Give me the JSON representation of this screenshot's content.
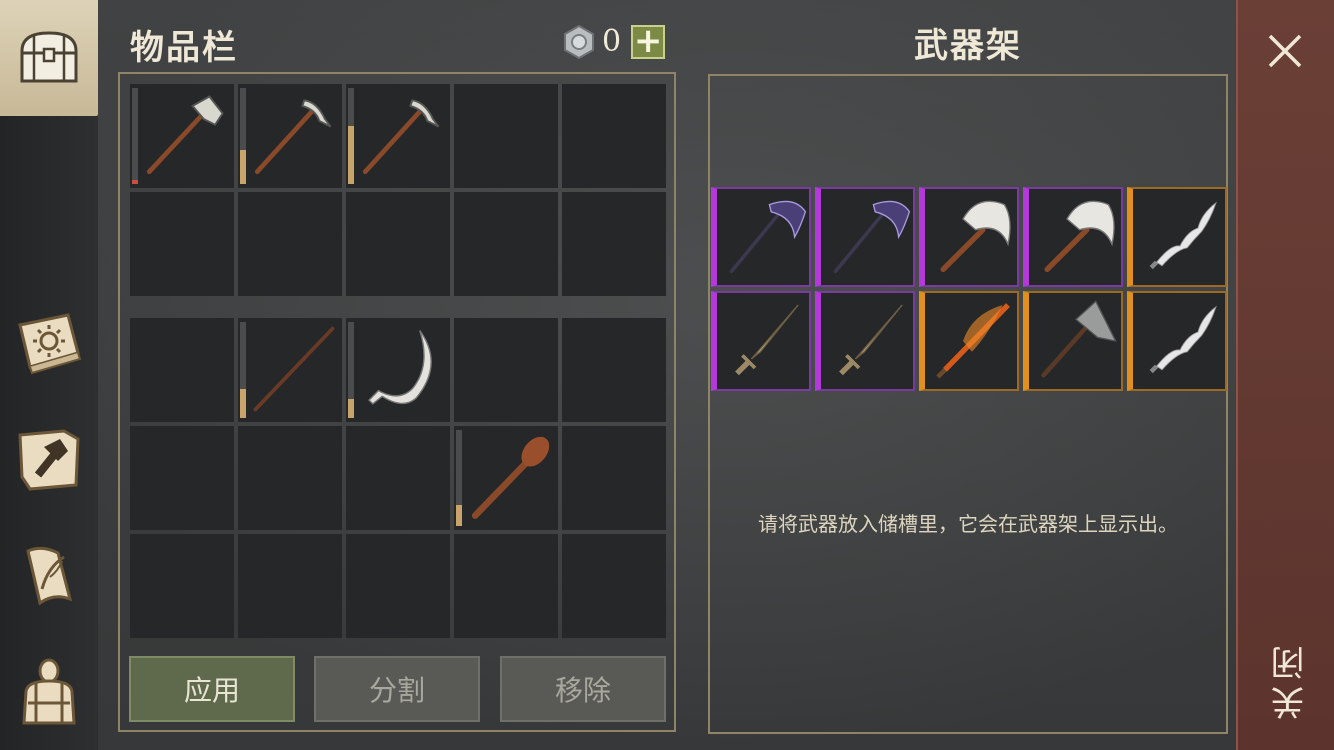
{
  "inventory": {
    "title": "物品栏",
    "currency_icon": "silver-coin-icon",
    "currency_value": "0",
    "add_currency_label": "+",
    "top_slots": [
      {
        "item": "stone-hammer",
        "durability": 0.04,
        "durability_color": "#c8503c"
      },
      {
        "item": "pickaxe",
        "durability": 0.35,
        "durability_color": "#c9a46a"
      },
      {
        "item": "pickaxe",
        "durability": 0.6,
        "durability_color": "#c9a46a"
      },
      {
        "item": null
      },
      {
        "item": null
      },
      {
        "item": null
      },
      {
        "item": null
      },
      {
        "item": null
      },
      {
        "item": null
      },
      {
        "item": null
      }
    ],
    "bottom_slots": [
      {
        "item": null
      },
      {
        "item": "spear-staff",
        "durability": 0.3,
        "durability_color": "#c9a46a"
      },
      {
        "item": "sickle",
        "durability": 0.2,
        "durability_color": "#c9a46a"
      },
      {
        "item": null
      },
      {
        "item": null
      },
      {
        "item": null
      },
      {
        "item": null
      },
      {
        "item": null
      },
      {
        "item": "wooden-club",
        "durability": 0.22,
        "durability_color": "#c9a46a"
      },
      {
        "item": null
      },
      {
        "item": null
      },
      {
        "item": null
      },
      {
        "item": null
      },
      {
        "item": null
      },
      {
        "item": null
      }
    ],
    "buttons": {
      "apply": "应用",
      "split": "分割",
      "remove": "移除"
    }
  },
  "rack": {
    "title": "武器架",
    "hint": "请将武器放入储槽里，它会在武器架上显示出。",
    "slots": [
      {
        "item": "dark-scythe",
        "rarity": "epic"
      },
      {
        "item": "dark-scythe",
        "rarity": "epic"
      },
      {
        "item": "crescent-axe",
        "rarity": "epic"
      },
      {
        "item": "crescent-axe",
        "rarity": "epic"
      },
      {
        "item": "wavy-blade",
        "rarity": "legendary"
      },
      {
        "item": "ornate-dagger",
        "rarity": "epic"
      },
      {
        "item": "ornate-dagger",
        "rarity": "epic"
      },
      {
        "item": "flaming-sword",
        "rarity": "legendary"
      },
      {
        "item": "engraved-axe",
        "rarity": "legendary"
      },
      {
        "item": "wavy-blade",
        "rarity": "legendary"
      }
    ]
  },
  "sidebar": {
    "tabs": [
      {
        "icon": "chest-icon",
        "active": true
      },
      {
        "icon": "sun-book-icon",
        "active": false
      },
      {
        "icon": "crafting-hammer-icon",
        "active": false
      },
      {
        "icon": "quill-scroll-icon",
        "active": false
      },
      {
        "icon": "character-backpack-icon",
        "active": false
      }
    ]
  },
  "close": {
    "label": "关闭",
    "icon": "close-x-icon"
  },
  "colors": {
    "epic": "#b33ad9",
    "legendary": "#e0901f",
    "apply_button": "#5f6a4c",
    "close_panel": "#6a3f36"
  }
}
